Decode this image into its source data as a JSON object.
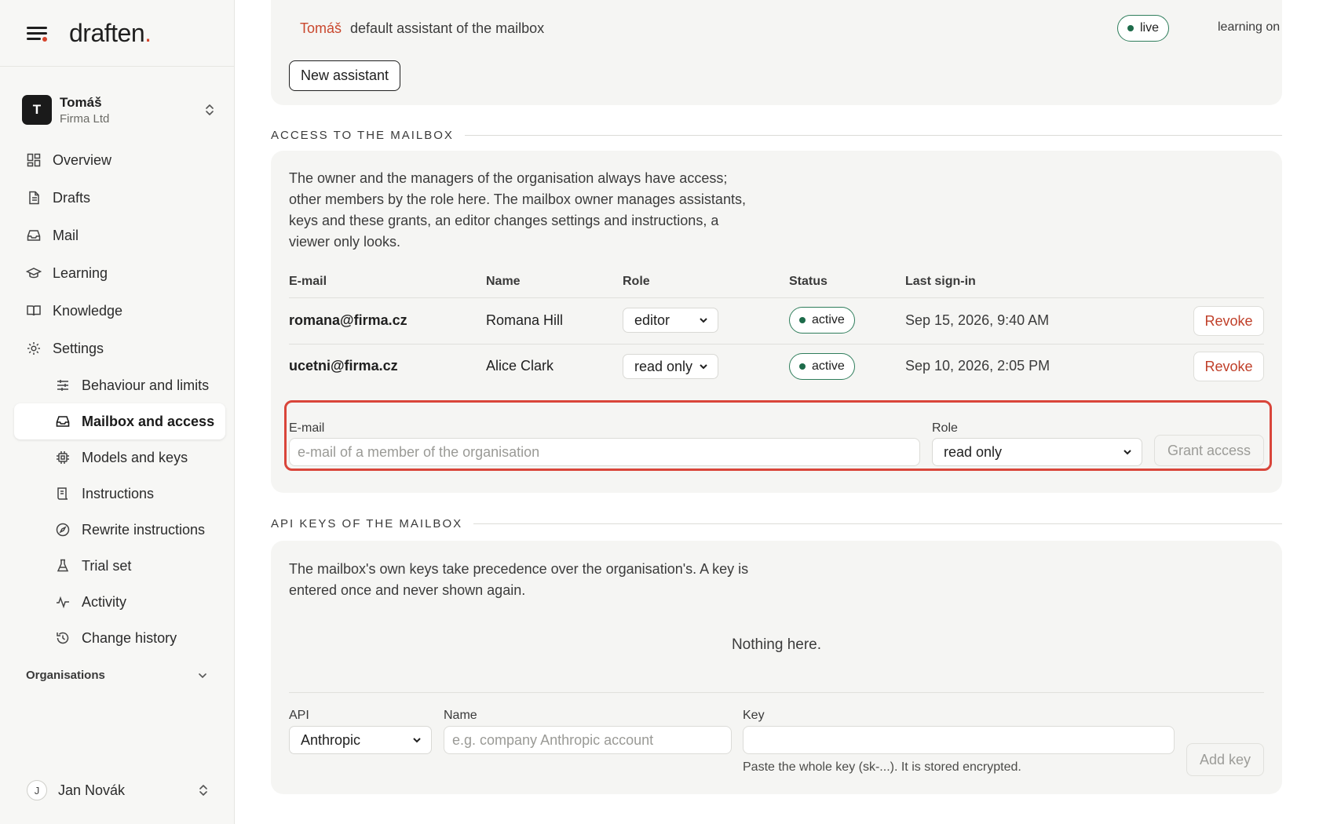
{
  "brand": {
    "logo": "draften",
    "logo_dot": "."
  },
  "account": {
    "initial": "T",
    "name": "Tomáš",
    "org": "Firma Ltd"
  },
  "nav": {
    "items": [
      {
        "label": "Overview",
        "icon": "grid-icon"
      },
      {
        "label": "Drafts",
        "icon": "document-icon"
      },
      {
        "label": "Mail",
        "icon": "inbox-icon"
      },
      {
        "label": "Learning",
        "icon": "graduation-cap-icon"
      },
      {
        "label": "Knowledge",
        "icon": "book-icon"
      },
      {
        "label": "Settings",
        "icon": "gear-icon"
      }
    ],
    "settings_items": [
      {
        "label": "Behaviour and limits",
        "icon": "sliders-icon"
      },
      {
        "label": "Mailbox and access",
        "icon": "inbox-icon",
        "active": true
      },
      {
        "label": "Models and keys",
        "icon": "chip-icon"
      },
      {
        "label": "Instructions",
        "icon": "scroll-icon"
      },
      {
        "label": "Rewrite instructions",
        "icon": "compass-icon"
      },
      {
        "label": "Trial set",
        "icon": "flask-icon"
      },
      {
        "label": "Activity",
        "icon": "pulse-icon"
      },
      {
        "label": "Change history",
        "icon": "history-icon"
      }
    ],
    "organisations_label": "Organisations"
  },
  "user": {
    "initial": "J",
    "name": "Jan Novák"
  },
  "assistant": {
    "owner": "Tomáš",
    "text": "default assistant of the mailbox",
    "status": "live",
    "learning": "learning on",
    "new_button": "New assistant"
  },
  "access": {
    "section_title": "ACCESS TO THE MAILBOX",
    "description": "The owner and the managers of the organisation always have access; other members by the role here. The mailbox owner manages assistants, keys and these grants, an editor changes settings and instructions, a viewer only looks.",
    "columns": [
      "E-mail",
      "Name",
      "Role",
      "Status",
      "Last sign-in"
    ],
    "rows": [
      {
        "email": "romana@firma.cz",
        "name": "Romana Hill",
        "role": "editor",
        "status": "active",
        "last": "Sep 15, 2026, 9:40 AM",
        "action": "Revoke"
      },
      {
        "email": "ucetni@firma.cz",
        "name": "Alice Clark",
        "role": "read only",
        "status": "active",
        "last": "Sep 10, 2026, 2:05 PM",
        "action": "Revoke"
      }
    ],
    "grant": {
      "email_label": "E-mail",
      "email_placeholder": "e-mail of a member of the organisation",
      "role_label": "Role",
      "role_value": "read only",
      "button": "Grant access"
    }
  },
  "api": {
    "section_title": "API KEYS OF THE MAILBOX",
    "description": "The mailbox's own keys take precedence over the organisation's. A key is entered once and never shown again.",
    "empty": "Nothing here.",
    "form": {
      "api_label": "API",
      "api_value": "Anthropic",
      "name_label": "Name",
      "name_placeholder": "e.g. company Anthropic account",
      "key_label": "Key",
      "key_hint": "Paste the whole key (sk-...). It is stored encrypted.",
      "button": "Add key"
    }
  },
  "colors": {
    "accent": "#d6452c",
    "status_green": "#1d6b4a",
    "highlight": "#d9453a"
  }
}
